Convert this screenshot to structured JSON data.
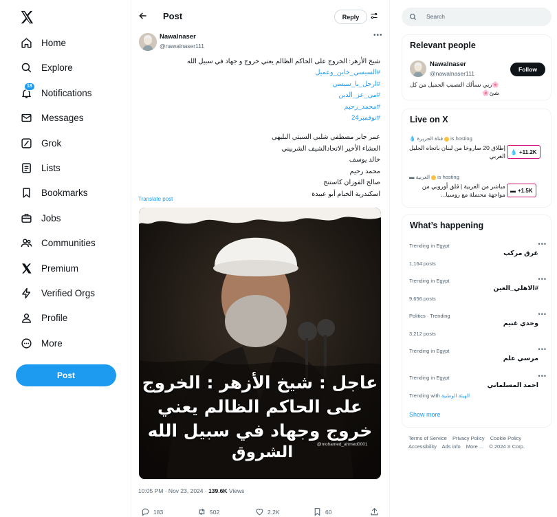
{
  "nav": {
    "items": [
      {
        "label": "Home",
        "icon": "home-icon"
      },
      {
        "label": "Explore",
        "icon": "search-icon"
      },
      {
        "label": "Notifications",
        "icon": "bell-icon",
        "badge": "18"
      },
      {
        "label": "Messages",
        "icon": "envelope-icon"
      },
      {
        "label": "Grok",
        "icon": "grok-icon"
      },
      {
        "label": "Lists",
        "icon": "list-icon"
      },
      {
        "label": "Bookmarks",
        "icon": "bookmark-icon"
      },
      {
        "label": "Jobs",
        "icon": "briefcase-icon"
      },
      {
        "label": "Communities",
        "icon": "people-icon"
      },
      {
        "label": "Premium",
        "icon": "x-logo-icon"
      },
      {
        "label": "Verified Orgs",
        "icon": "lightning-icon"
      },
      {
        "label": "Profile",
        "icon": "person-icon"
      },
      {
        "label": "More",
        "icon": "more-circle-icon"
      }
    ],
    "post_label": "Post"
  },
  "header": {
    "title": "Post",
    "reply_label": "Reply"
  },
  "post": {
    "author_name": "Nawalnaser",
    "author_handle": "@nawalnaser111",
    "text_line1": "شيخ الأزهر: الخروج على الحاكم الظالم يعني خروج و جهاد في سبيل الله",
    "hashtags": [
      "#السيسي_خاين_وعميل",
      "#ارحل_يا_سيسي",
      "#مي_عز_الدين",
      "#محمد_رحيم",
      "#نوفمبر24"
    ],
    "names": [
      "عمر جابر مصطفي شلبي السيتي  البليهي",
      "العشاء الأخير الاتحادالشيف الشربيني",
      "خالد يوسف",
      "محمد رحيم",
      "صالح الفوزان  كاستنج",
      "اسكندرية الخيام أبو عبيدة"
    ],
    "translate_label": "Translate post",
    "media": {
      "headline_line1": "عاجل : شيخ الأزهر : الخروج",
      "headline_line2": "على الحاكم الظالم يعني",
      "headline_line3": "خروج وجهاد في سبيل الله",
      "brand": "الشروق",
      "watermark": "@mohamed_ahmed0001"
    },
    "timestamp": "10:05 PM · Nov 23, 2024 · ",
    "views": "139.6K",
    "views_label": " Views",
    "replies": "183",
    "reposts": "502",
    "likes": "2.2K",
    "bookmarks": "60"
  },
  "search": {
    "placeholder": "Search"
  },
  "relevant": {
    "title": "Relevant people",
    "name": "Nawalnaser",
    "handle": "@nawalnaser111",
    "follow_label": "Follow",
    "bio": "🌸ربي نسألك التصبب الجميل من كل شئ🌸"
  },
  "live": {
    "title": "Live on X",
    "items": [
      {
        "host": "قناة الجزيرة",
        "hosting": "is hosting",
        "text": "إطلاق 20 صاروخا من لبنان باتجاه الجليل الغربي",
        "count": "+11.2K"
      },
      {
        "host": "العربية",
        "hosting": "is hosting",
        "text": "مباشر من العربية | قلق أوروبي من مواجهة محتملة مع روسيا...",
        "count": "+1.5K"
      }
    ]
  },
  "trending": {
    "title": "What’s happening",
    "items": [
      {
        "context": "Trending in Egypt",
        "title": "غرق مركب",
        "count": "1,164 posts"
      },
      {
        "context": "Trending in Egypt",
        "title": "#الاهلي_العين",
        "count": "9,656 posts"
      },
      {
        "context": "Politics · Trending",
        "title": "وحدي غنيم",
        "count": "3,212 posts"
      },
      {
        "context": "Trending in Egypt",
        "title": "مرسي علم",
        "count": ""
      },
      {
        "context": "Trending in Egypt",
        "title": "احمد المسلماني",
        "with_label": "Trending with",
        "with_value": "الهيئة الوطنية"
      }
    ],
    "show_more": "Show more"
  },
  "footer": {
    "links": [
      "Terms of Service",
      "Privacy Policy",
      "Cookie Policy",
      "Accessibility",
      "Ads info",
      "More ...",
      "© 2024 X Corp."
    ]
  }
}
